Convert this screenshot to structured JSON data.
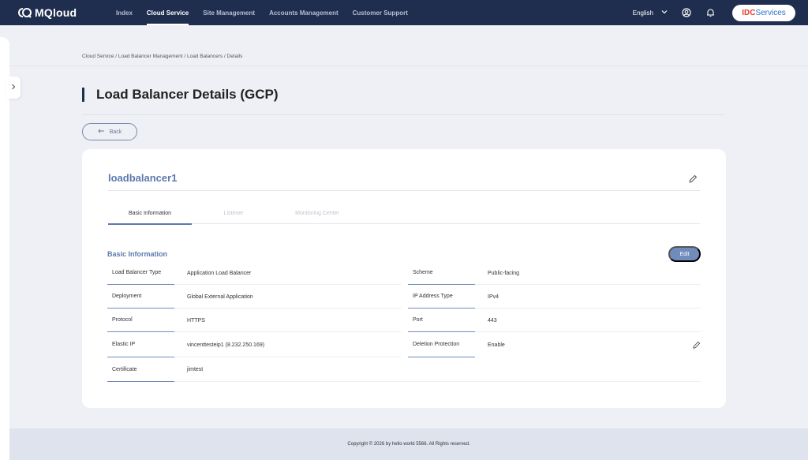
{
  "nav": {
    "logo_text": "MQloud",
    "items": [
      {
        "label": "Index"
      },
      {
        "label": "Cloud Service"
      },
      {
        "label": "Site Management"
      },
      {
        "label": "Accounts Management"
      },
      {
        "label": "Customer Support"
      }
    ],
    "active_index": 1,
    "language": "English",
    "brand": {
      "part1": "IDC",
      "part2": "Services"
    }
  },
  "breadcrumb": "Cloud Service / Load Balancer Management / Load Balancers / Details",
  "page_title": "Load Balancer Details (GCP)",
  "back_label": "Back",
  "card": {
    "name": "loadbalancer1",
    "tabs": [
      {
        "label": "Basic Information"
      },
      {
        "label": "Listener"
      },
      {
        "label": "Monitoring Center"
      }
    ],
    "active_tab": 0,
    "section_title": "Basic Information",
    "edit_label": "Edit",
    "left_rows": [
      {
        "label": "Load Balancer Type",
        "value": "Application Load Balancer"
      },
      {
        "label": "Deployment",
        "value": "Global External Application"
      },
      {
        "label": "Protocol",
        "value": "HTTPS"
      },
      {
        "label": "Elastic IP",
        "value": "vincenttesteip1 (8.232.250.169)"
      },
      {
        "label": "Certificate",
        "value": "jimtest"
      }
    ],
    "right_rows": [
      {
        "label": "Scheme",
        "value": "Public-facing"
      },
      {
        "label": "IP Address Type",
        "value": "IPv4"
      },
      {
        "label": "Port",
        "value": "443"
      },
      {
        "label": "Deletion Protection",
        "value": "Enable"
      }
    ]
  },
  "footer": "Copyright © 2026 by hello world 5566. All Rights reserved.",
  "colors": {
    "nav_bg": "#1f2d4e",
    "accent": "#5b79ae",
    "edit_button": "#6f8cbd",
    "page_bg": "#eef0f5",
    "footer_bg": "#dfe3ee"
  },
  "icons": {
    "user": "user-circle-icon",
    "bell": "bell-icon",
    "pencil": "pencil-icon",
    "chevron": "chevron-right-icon"
  }
}
